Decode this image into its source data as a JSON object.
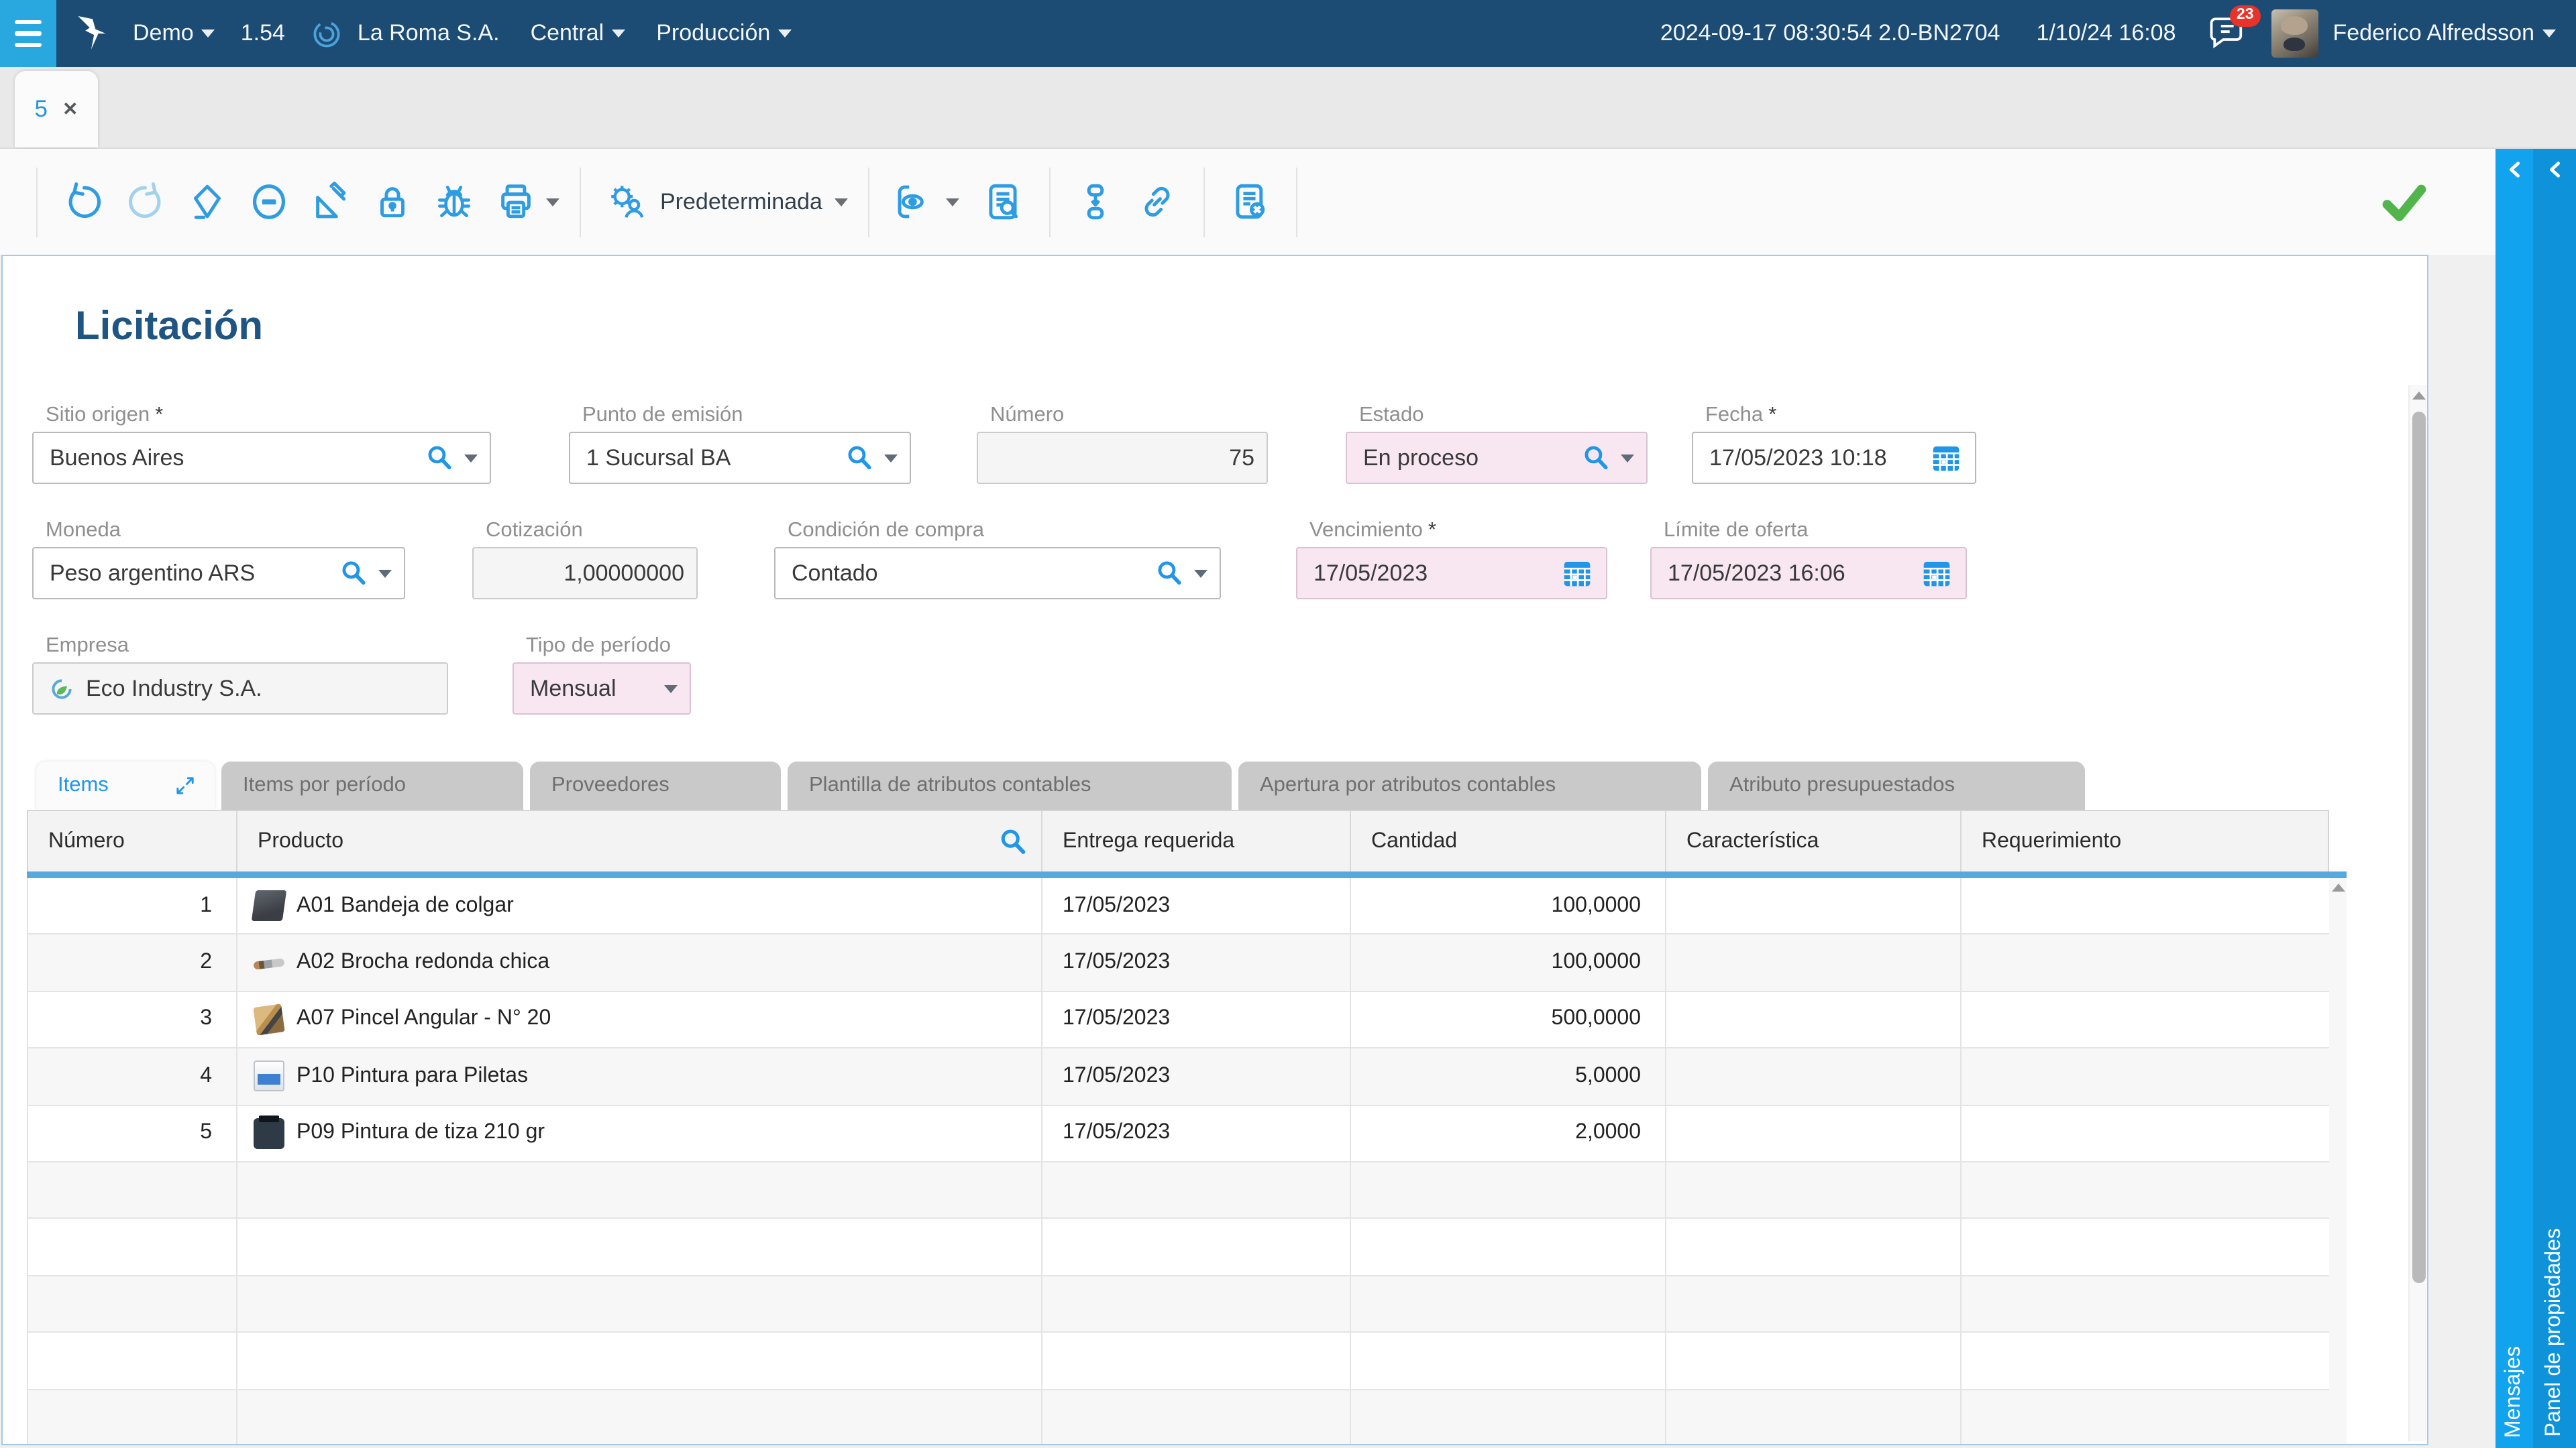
{
  "colors": {
    "topbar_navy": "#1c4b74",
    "accent_blue": "#29a8e0",
    "icon_blue": "#2d9ce2",
    "panel_strip_blue": "#12a3ee",
    "panel_strip_blue_dark": "#0e93db",
    "pink_field_bg": "#f8e7f1",
    "success_green": "#52b54b",
    "header_underline_blue": "#56a9de",
    "title_navy": "#1f5582"
  },
  "topbar": {
    "workspace": "Demo",
    "version": "1.54",
    "company": "La Roma S.A.",
    "branch": "Central",
    "environment": "Producción",
    "build_info": "2024-09-17 08:30:54 2.0-BN2704",
    "session_datetime": "1/10/24 16:08",
    "notifications_count": "23",
    "user_name": "Federico Alfredsson"
  },
  "tabstrip": {
    "active_tab_label": "5"
  },
  "toolbar": {
    "view_selector_label": "Predeterminada"
  },
  "form": {
    "title": "Licitación",
    "required_marker": "*",
    "fields": {
      "sitio_origen": {
        "label": "Sitio origen",
        "value": "Buenos Aires"
      },
      "punto_emision": {
        "label": "Punto de emisión",
        "value": "1 Sucursal BA"
      },
      "numero": {
        "label": "Número",
        "value": "75"
      },
      "estado": {
        "label": "Estado",
        "value": "En proceso"
      },
      "fecha": {
        "label": "Fecha",
        "value": "17/05/2023 10:18"
      },
      "moneda": {
        "label": "Moneda",
        "value": "Peso argentino ARS"
      },
      "cotizacion": {
        "label": "Cotización",
        "value": "1,00000000"
      },
      "condicion_compra": {
        "label": "Condición de compra",
        "value": "Contado"
      },
      "vencimiento": {
        "label": "Vencimiento",
        "value": "17/05/2023"
      },
      "limite_oferta": {
        "label": "Límite de oferta",
        "value": "17/05/2023 16:06"
      },
      "empresa": {
        "label": "Empresa",
        "value": "Eco Industry S.A."
      },
      "tipo_periodo": {
        "label": "Tipo de período",
        "value": "Mensual"
      }
    }
  },
  "detail_tabs": [
    {
      "label": "Items",
      "active": true
    },
    {
      "label": "Items por período"
    },
    {
      "label": "Proveedores"
    },
    {
      "label": "Plantilla de atributos contables"
    },
    {
      "label": "Apertura por atributos contables"
    },
    {
      "label": "Atributo presupuestados"
    }
  ],
  "items_table": {
    "columns": [
      "Número",
      "Producto",
      "Entrega requerida",
      "Cantidad",
      "Característica",
      "Requerimiento"
    ],
    "rows": [
      {
        "numero": "1",
        "icon": "product-tray",
        "producto": "A01 Bandeja de colgar",
        "entrega": "17/05/2023",
        "cantidad": "100,0000",
        "caracteristica": "",
        "requerimiento": ""
      },
      {
        "numero": "2",
        "icon": "product-brush-round",
        "producto": "A02 Brocha redonda chica",
        "entrega": "17/05/2023",
        "cantidad": "100,0000",
        "caracteristica": "",
        "requerimiento": ""
      },
      {
        "numero": "3",
        "icon": "product-brush-angular",
        "producto": "A07 Pincel Angular - N° 20",
        "entrega": "17/05/2023",
        "cantidad": "500,0000",
        "caracteristica": "",
        "requerimiento": ""
      },
      {
        "numero": "4",
        "icon": "product-paint-bucket",
        "producto": "P10 Pintura para Piletas",
        "entrega": "17/05/2023",
        "cantidad": "5,0000",
        "caracteristica": "",
        "requerimiento": ""
      },
      {
        "numero": "5",
        "icon": "product-paint-jar",
        "producto": "P09 Pintura de tiza 210 gr",
        "entrega": "17/05/2023",
        "cantidad": "2,0000",
        "caracteristica": "",
        "requerimiento": ""
      }
    ],
    "empty_row_count": 5
  },
  "side_panels": [
    {
      "label": "Mensajes"
    },
    {
      "label": "Panel de propiedades"
    }
  ]
}
